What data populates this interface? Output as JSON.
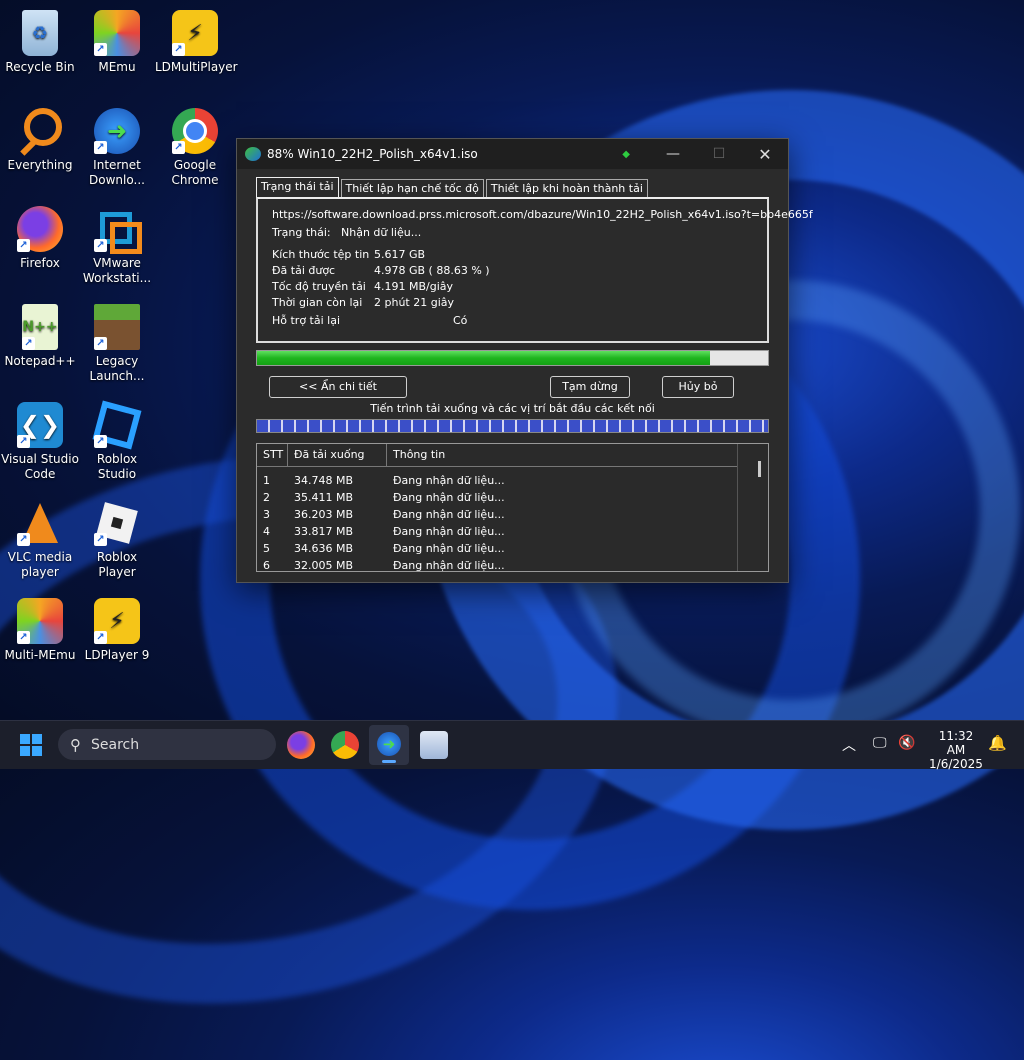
{
  "desktop": {
    "icons": [
      {
        "label": "Recycle Bin"
      },
      {
        "label": "MEmu"
      },
      {
        "label": "LDMultiPlayer"
      },
      {
        "label": "Everything"
      },
      {
        "label": "Internet Downlo..."
      },
      {
        "label": "Google Chrome"
      },
      {
        "label": "Firefox"
      },
      {
        "label": "VMware Workstati..."
      },
      {
        "label": "Notepad++"
      },
      {
        "label": "Legacy Launch..."
      },
      {
        "label": "Visual Studio Code"
      },
      {
        "label": "Roblox Studio"
      },
      {
        "label": "VLC media player"
      },
      {
        "label": "Roblox Player"
      },
      {
        "label": "Multi-MEmu"
      },
      {
        "label": "LDPlayer 9"
      }
    ]
  },
  "window": {
    "title": "88% Win10_22H2_Polish_x64v1.iso",
    "tabs": [
      "Trạng thái tải",
      "Thiết lập hạn chế tốc độ",
      "Thiết lập khi hoàn thành tải"
    ],
    "url": "https://software.download.prss.microsoft.com/dbazure/Win10_22H2_Polish_x64v1.iso?t=bb4e665f",
    "status_label": "Trạng thái:",
    "status_value": "Nhận dữ liệu...",
    "info": [
      {
        "label": "Kích thước tệp tin",
        "value": "5.617  GB"
      },
      {
        "label": "Đã tải được",
        "value": "4.978  GB  ( 88.63 % )"
      },
      {
        "label": "Tốc độ truyền tải",
        "value": "4.191  MB/giây"
      },
      {
        "label": "Thời gian còn lại",
        "value": "2 phút 21 giây"
      },
      {
        "label": "Hỗ trợ tải lại",
        "value": "Có"
      }
    ],
    "progress_fraction": 0.8863,
    "buttons": {
      "hide_details": "<< Ẩn chi tiết",
      "pause": "Tạm dừng",
      "cancel": "Hủy bỏ"
    },
    "segments_caption": "Tiến trình tải xuống và các vị trí bắt đầu các kết nối",
    "list": {
      "headers": [
        "STT",
        "Đã tải xuống",
        "Thông tin"
      ],
      "rows": [
        {
          "n": "1",
          "size": "34.748  MB",
          "info": "Đang nhận dữ liệu..."
        },
        {
          "n": "2",
          "size": "35.411  MB",
          "info": "Đang nhận dữ liệu..."
        },
        {
          "n": "3",
          "size": "36.203  MB",
          "info": "Đang nhận dữ liệu..."
        },
        {
          "n": "4",
          "size": "33.817  MB",
          "info": "Đang nhận dữ liệu..."
        },
        {
          "n": "5",
          "size": "34.636  MB",
          "info": "Đang nhận dữ liệu..."
        },
        {
          "n": "6",
          "size": "32.005  MB",
          "info": "Đang nhận dữ liệu..."
        }
      ]
    }
  },
  "taskbar": {
    "search_label": "Search",
    "time": "11:32 AM",
    "date": "1/6/2025"
  }
}
